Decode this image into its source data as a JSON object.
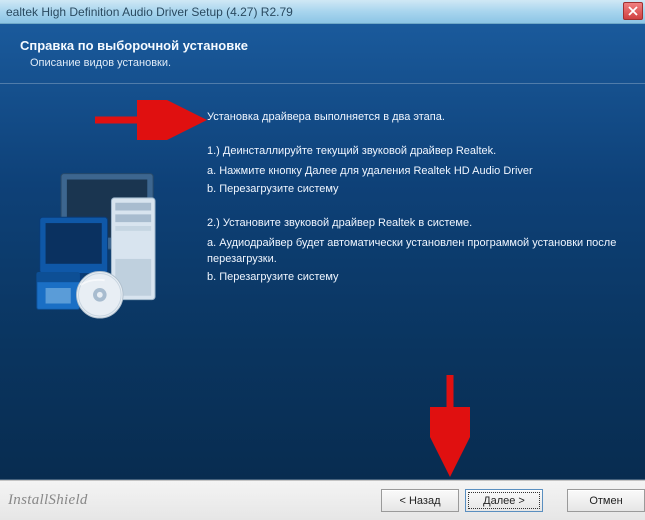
{
  "titlebar": {
    "title": "ealtek High Definition Audio Driver Setup (4.27) R2.79"
  },
  "header": {
    "title": "Справка по выборочной установке",
    "subtitle": "Описание видов установки."
  },
  "content": {
    "intro": "Установка драйвера выполняется в два этапа.",
    "step1_head": "1.) Деинсталлируйте текущий звуковой драйвер Realtek.",
    "step1_a": "a. Нажмите кнопку Далее для удаления Realtek HD Audio Driver",
    "step1_b": "b. Перезагрузите систему",
    "step2_head": "2.) Установите звуковой драйвер Realtek в системе.",
    "step2_a": "a. Аудиодрайвер будет автоматически установлен программой установки после перезагрузки.",
    "step2_b": "b. Перезагрузите систему"
  },
  "footer": {
    "brand": "InstallShield",
    "back": "< Назад",
    "next": "Далее >",
    "cancel": "Отмен"
  }
}
